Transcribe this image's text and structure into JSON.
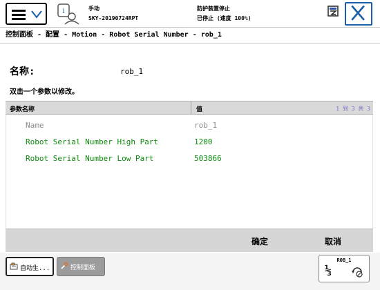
{
  "header": {
    "mode": "手动",
    "system_name": "SKY-20190724RPT",
    "guard_status": "防护装置停止",
    "run_status": "已停止 (速度 100%)"
  },
  "breadcrumb": "控制面板 - 配置 - Motion - Robot Serial Number - rob_1",
  "instance": {
    "name_label": "名称:",
    "name_value": "rob_1",
    "instruction": "双击一个参数以修改。"
  },
  "table": {
    "col_name": "参数名称",
    "col_value": "值",
    "page_indicator": "1 到 3 共 3",
    "rows": [
      {
        "name": "Name",
        "value": "rob_1",
        "color": "#8c8c8c"
      },
      {
        "name": "Robot Serial Number High Part",
        "value": "1200",
        "color": "#0a8a0a"
      },
      {
        "name": "Robot Serial Number Low Part",
        "value": "503866",
        "color": "#0a8a0a"
      }
    ]
  },
  "commands": {
    "ok": "确定",
    "cancel": "取消"
  },
  "taskbar": {
    "auto_label": "自动生...",
    "panel_label": "控制面板",
    "quickset_title": "ROB_1",
    "quickset_speed": "⅓"
  },
  "colors": {
    "accent": "#1a5ea8",
    "changed_param": "#0a8a0a",
    "readonly_param": "#8c8c8c"
  }
}
